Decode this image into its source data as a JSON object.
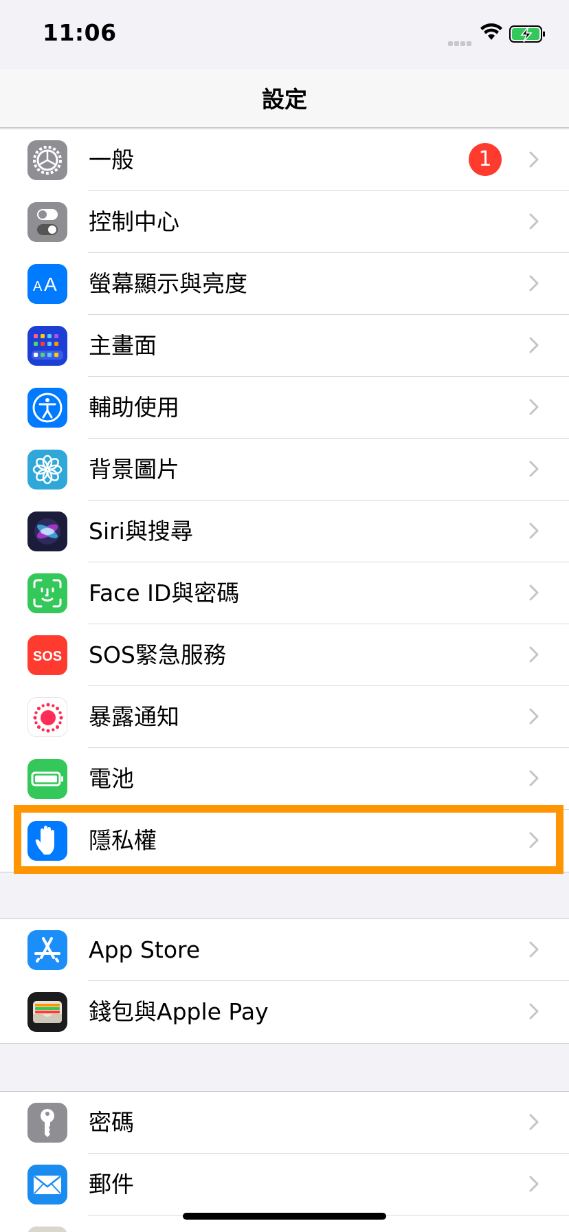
{
  "status_bar": {
    "time": "11:06"
  },
  "nav": {
    "title": "設定"
  },
  "groups": [
    {
      "items": [
        {
          "label": "一般",
          "icon": "gear-icon",
          "badge": "1"
        },
        {
          "label": "控制中心",
          "icon": "toggles-icon"
        },
        {
          "label": "螢幕顯示與亮度",
          "icon": "text-size-icon"
        },
        {
          "label": "主畫面",
          "icon": "home-grid-icon"
        },
        {
          "label": "輔助使用",
          "icon": "accessibility-icon"
        },
        {
          "label": "背景圖片",
          "icon": "flower-icon"
        },
        {
          "label": "Siri與搜尋",
          "icon": "siri-icon"
        },
        {
          "label": "Face ID與密碼",
          "icon": "face-id-icon"
        },
        {
          "label": "SOS緊急服務",
          "icon": "sos-icon"
        },
        {
          "label": "暴露通知",
          "icon": "exposure-icon"
        },
        {
          "label": "電池",
          "icon": "battery-icon"
        },
        {
          "label": "隱私權",
          "icon": "hand-icon"
        }
      ]
    },
    {
      "items": [
        {
          "label": "App Store",
          "icon": "app-store-icon"
        },
        {
          "label": "錢包與Apple Pay",
          "icon": "wallet-icon"
        }
      ]
    },
    {
      "items": [
        {
          "label": "密碼",
          "icon": "key-icon"
        },
        {
          "label": "郵件",
          "icon": "mail-icon"
        }
      ]
    }
  ],
  "colors": {
    "highlight": "#ff9500",
    "badge": "#ff3b30",
    "accent": "#007aff"
  }
}
